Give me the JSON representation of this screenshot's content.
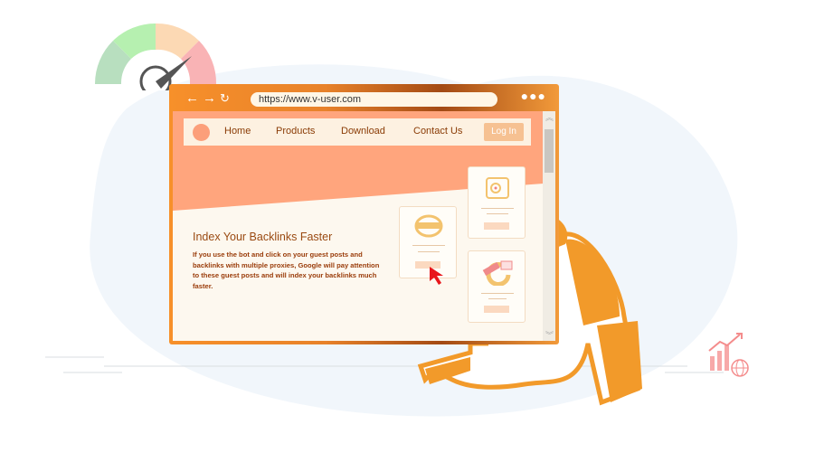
{
  "browser": {
    "url": "https://www.v-user.com",
    "back_icon": "arrow-left",
    "forward_icon": "arrow-right",
    "reload_icon": "reload",
    "menu_icon": "three-dots"
  },
  "nav": {
    "items": [
      {
        "label": "Home"
      },
      {
        "label": "Products"
      },
      {
        "label": "Download"
      },
      {
        "label": "Contact Us"
      }
    ],
    "login_label": "Log In"
  },
  "hero": {
    "title": "Index Your Backlinks Faster",
    "text": "If you use the bot and click on your guest posts and backlinks with multiple proxies, Google will pay attention to these guest posts and will index your backlinks much faster."
  },
  "colors": {
    "accent": "#f7902a",
    "salmon": "#ffa57d",
    "text": "#9a4a12",
    "cursor": "#e8161b"
  }
}
